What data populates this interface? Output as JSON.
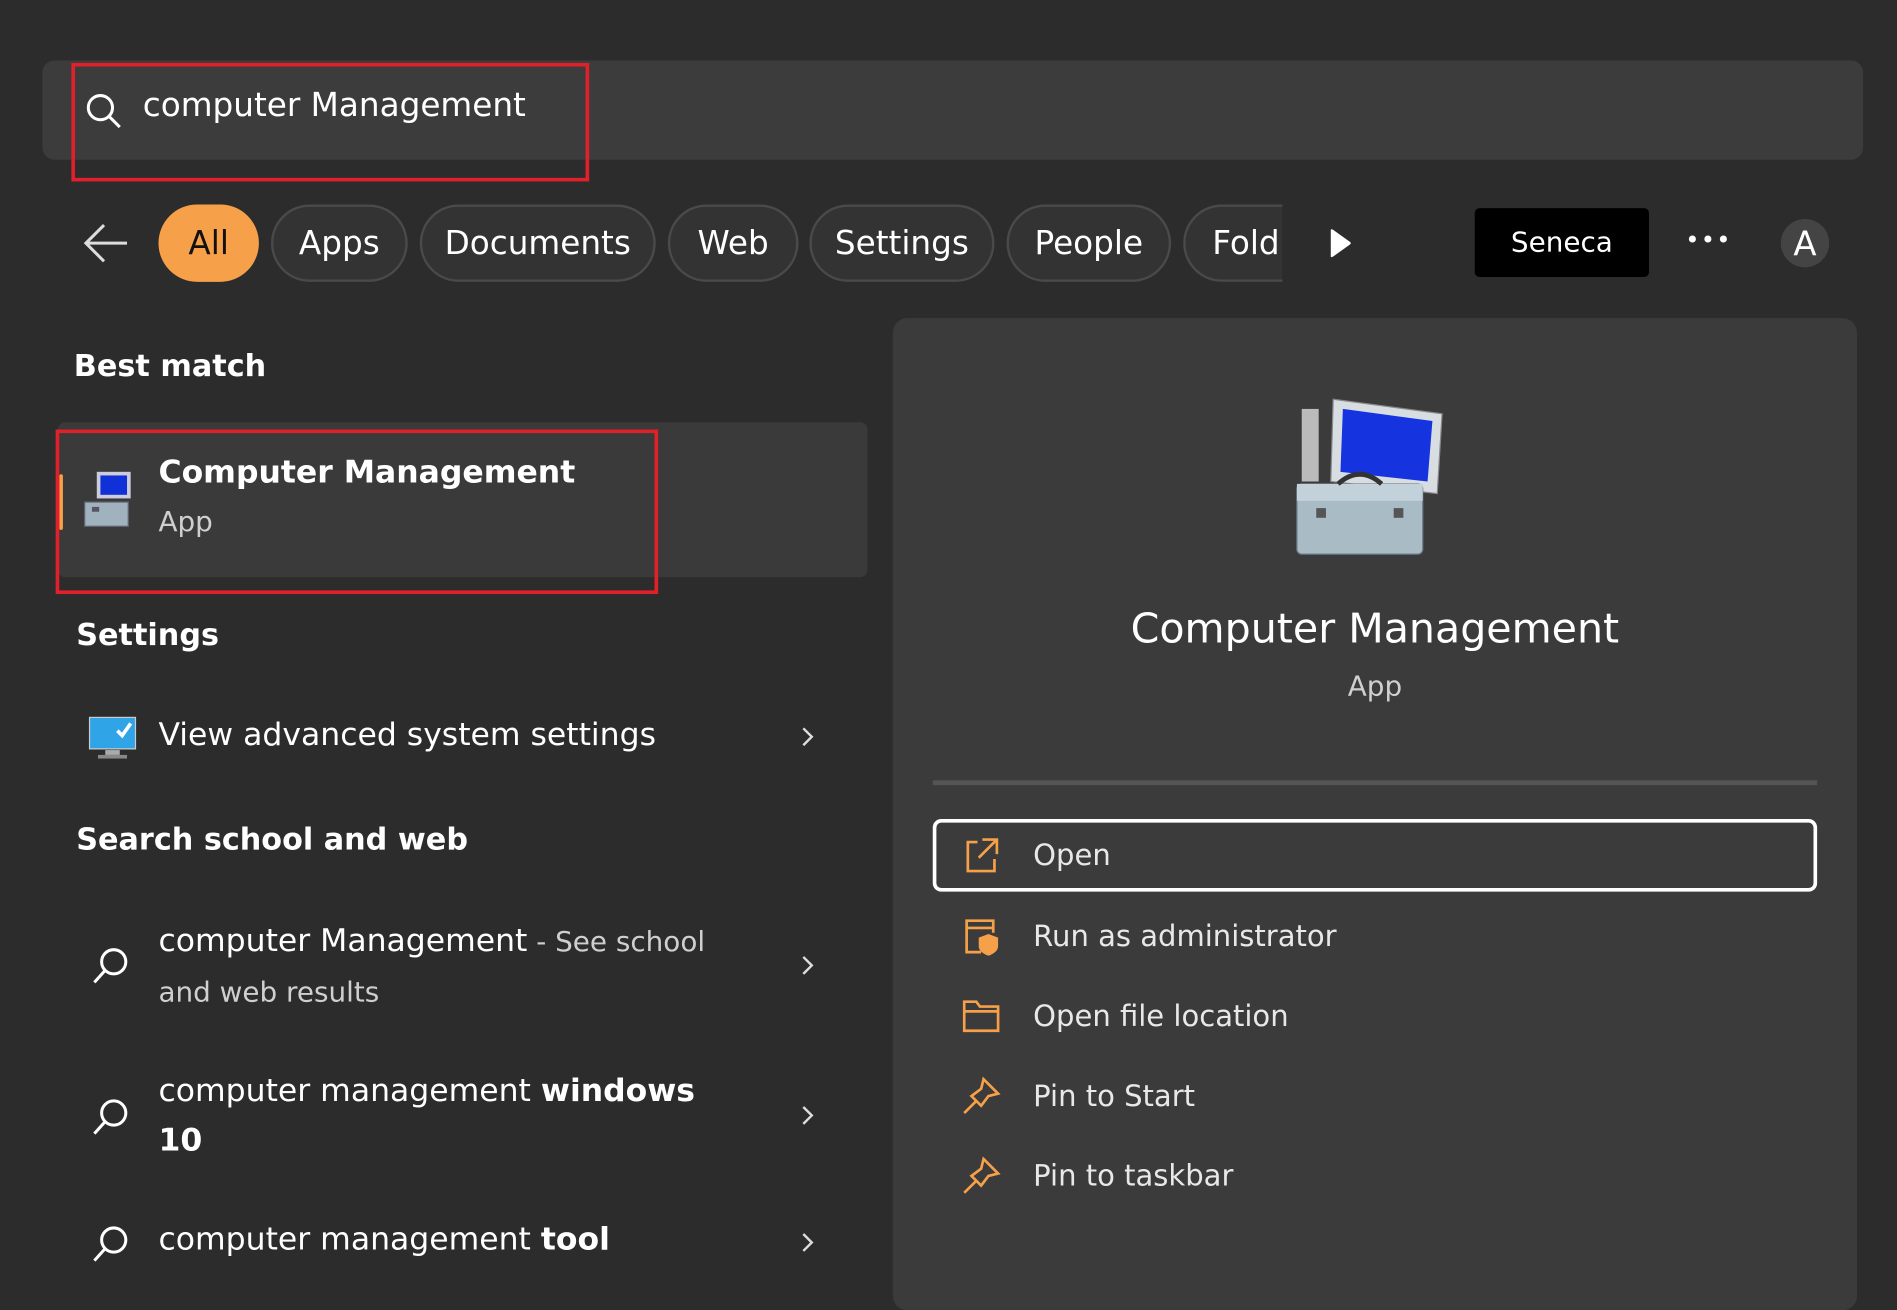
{
  "search": {
    "query": "computer Management"
  },
  "filters": {
    "tabs": [
      {
        "label": "All",
        "active": true
      },
      {
        "label": "Apps"
      },
      {
        "label": "Documents"
      },
      {
        "label": "Web"
      },
      {
        "label": "Settings"
      },
      {
        "label": "People"
      },
      {
        "label": "Fold"
      }
    ],
    "org_label": "Seneca",
    "more_label": "•••",
    "avatar_letter": "A"
  },
  "best_match": {
    "heading": "Best match",
    "title": "Computer Management",
    "subtitle": "App"
  },
  "settings": {
    "heading": "Settings",
    "items": [
      {
        "label": "View advanced system settings"
      }
    ]
  },
  "web": {
    "heading": "Search school and web",
    "items": [
      {
        "normal": "computer Management",
        "suffix": " - See school",
        "line2": "and web results"
      },
      {
        "normal": "computer management ",
        "bold": "windows",
        "line2": "10"
      },
      {
        "normal": "computer management ",
        "bold": "tool"
      }
    ]
  },
  "preview": {
    "title": "Computer Management",
    "subtitle": "App",
    "actions": [
      {
        "label": "Open",
        "icon": "open-external-icon"
      },
      {
        "label": "Run as administrator",
        "icon": "shield-admin-icon"
      },
      {
        "label": "Open file location",
        "icon": "folder-icon"
      },
      {
        "label": "Pin to Start",
        "icon": "pin-icon"
      },
      {
        "label": "Pin to taskbar",
        "icon": "pin-icon"
      }
    ]
  },
  "colors": {
    "accent": "#f7a04a",
    "highlight_box": "#e0202a",
    "background": "#2c2c2c",
    "panel": "#3b3b3b"
  }
}
